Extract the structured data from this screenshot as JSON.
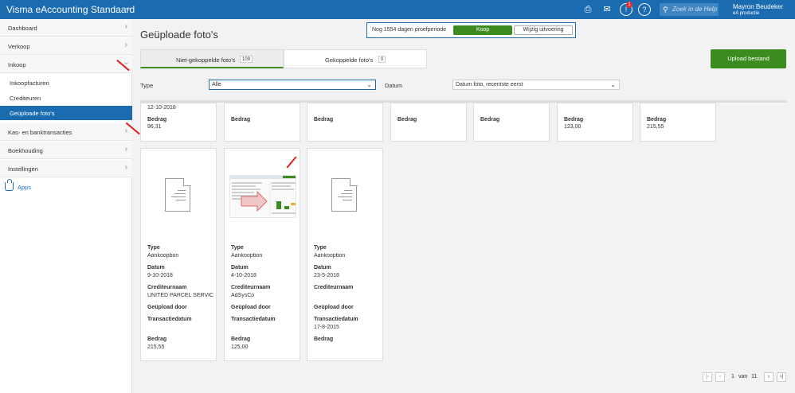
{
  "topbar": {
    "app_title": "Visma eAccounting Standaard",
    "notification_count": "1",
    "search_placeholder": "Zoek in de Help",
    "user_name": "Mayron Beudeker",
    "user_org": "eA productie"
  },
  "sidebar": {
    "items": [
      {
        "label": "Dashboard"
      },
      {
        "label": "Verkoop"
      },
      {
        "label": "Inkoop"
      },
      {
        "label": "Kas- en banktransacties"
      },
      {
        "label": "Boekhouding"
      },
      {
        "label": "Instellingen"
      }
    ],
    "sub_items": [
      {
        "label": "Inkoopfacturen"
      },
      {
        "label": "Crediteuren"
      },
      {
        "label": "Geüploade foto's"
      }
    ],
    "apps_label": "Apps"
  },
  "main": {
    "page_title": "Geüploade foto's",
    "trial": {
      "text": "Nog 1554 dagen proefperiode",
      "buy_label": "Koop",
      "change_label": "Wijzig uitvoering"
    },
    "tabs": [
      {
        "label": "Niet-gekoppelde foto's",
        "count": "109"
      },
      {
        "label": "Gekoppelde foto's",
        "count": "0"
      }
    ],
    "upload_label": "Upload bestand",
    "filters": {
      "type_label": "Type",
      "type_value": "Alle",
      "date_label": "Datum",
      "date_value": "Datum foto, recentste eerst"
    }
  },
  "labels": {
    "type": "Type",
    "datum": "Datum",
    "crediteur": "Crediteurnaam",
    "uploaded_by": "Geüpload door",
    "transaction_date": "Transactiedatum",
    "bedrag": "Bedrag"
  },
  "top_cards": [
    {
      "date": "12-10-2018",
      "amount": "96,31"
    },
    {
      "date": "",
      "amount": ""
    },
    {
      "date": "",
      "amount": ""
    },
    {
      "date": "",
      "amount": ""
    },
    {
      "date": "",
      "amount": ""
    },
    {
      "date": "",
      "amount": "123,00"
    },
    {
      "date": "",
      "amount": "215,55"
    }
  ],
  "cards": [
    {
      "type": "Aankoopbon",
      "date": "9-10-2018",
      "creditor": "UNITED PARCEL SERVIC...",
      "uploaded_by": "",
      "transaction_date": "",
      "amount": "215,55"
    },
    {
      "type": "Aankoopbon",
      "date": "4-10-2018",
      "creditor": "AdSysCo",
      "uploaded_by": "",
      "transaction_date": "",
      "amount": "125,00"
    },
    {
      "type": "Aankoopbon",
      "date": "23-5-2018",
      "creditor": "",
      "uploaded_by": "",
      "transaction_date": "17-8-2015",
      "amount": ""
    }
  ],
  "pagination": {
    "current": "1",
    "of_label": "van",
    "total": "11"
  }
}
